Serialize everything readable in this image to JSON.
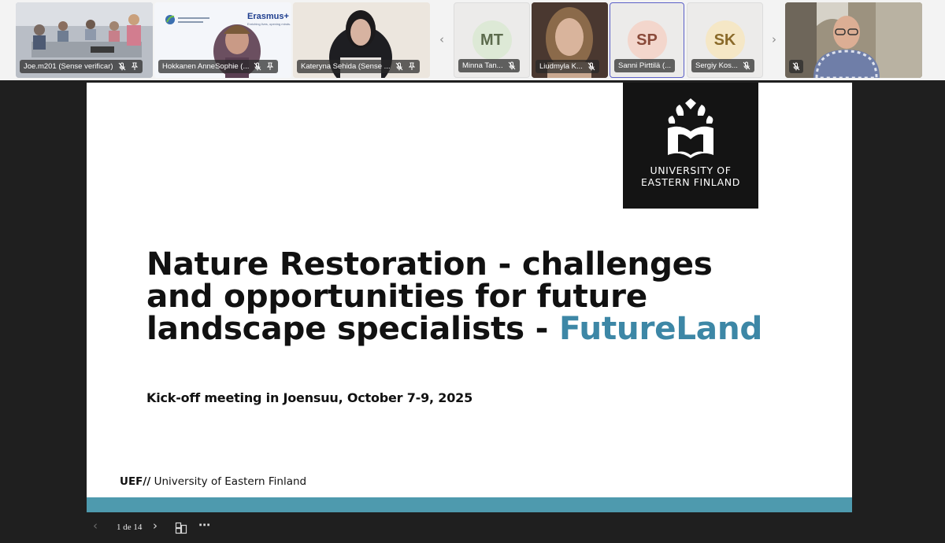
{
  "participants": [
    {
      "name": "Joe.m201 (Sense verificar)",
      "muted": true,
      "pinned": true
    },
    {
      "name": "Hokkanen AnneSophie (...",
      "muted": true,
      "pinned": true,
      "banner": "Erasmus+",
      "banner_tagline": "Enriching lives, opening minds."
    },
    {
      "name": "Kateryna Sehida (Sense ...",
      "muted": true,
      "pinned": true
    },
    {
      "name": "Minna Tan...",
      "initials": "MT",
      "muted": true,
      "avatar_bg": "#dde9d6",
      "avatar_fg": "#5c6b4d"
    },
    {
      "name": "Liudmyla K...",
      "muted": true
    },
    {
      "name": "Sanni Pirttilä (...",
      "initials": "SP",
      "muted": false,
      "selected": true,
      "avatar_bg": "#f3d6cc",
      "avatar_fg": "#8a4a3a"
    },
    {
      "name": "Sergiy Kos...",
      "initials": "SK",
      "muted": true,
      "avatar_bg": "#f5e7c6",
      "avatar_fg": "#8a6a2a"
    },
    {
      "name": "",
      "muted": true
    }
  ],
  "nav": {
    "prev_icon": "chevron-left-icon",
    "next_icon": "chevron-right-icon"
  },
  "slide": {
    "logo_line1": "UNIVERSITY OF",
    "logo_line2": "EASTERN FINLAND",
    "title_main": "Nature Restoration - challenges and opportunities for future landscape specialists - ",
    "title_accent": "FutureLand",
    "subtitle": "Kick-off meeting in Joensuu, October 7-9, 2025",
    "footer_brand": "UEF//",
    "footer_text": " University of Eastern Finland",
    "accent_color": "#3d87a6",
    "band_color": "#4e9aae"
  },
  "controls": {
    "page_indicator": "1 de 14"
  }
}
